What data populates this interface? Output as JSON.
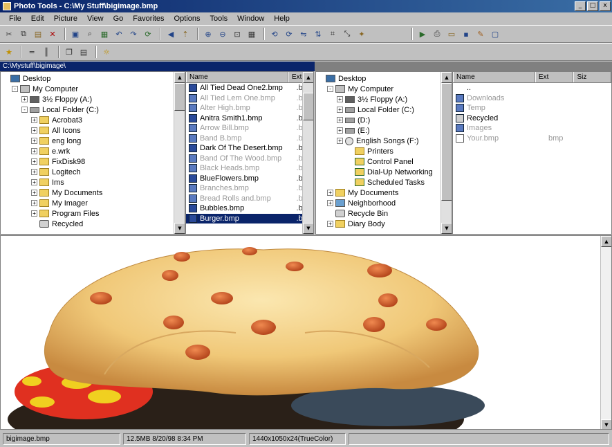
{
  "window": {
    "title": "Photo Tools - C:\\My Stuff\\bigimage.bmp",
    "minimize_label": "_",
    "maximize_label": "□",
    "close_label": "x"
  },
  "menu": [
    "File",
    "Edit",
    "Picture",
    "View",
    "Go",
    "Favorites",
    "Options",
    "Tools",
    "Window",
    "Help"
  ],
  "path_bar": {
    "text": "C:\\Mystuff\\bigimage\\"
  },
  "left_tree": [
    {
      "label": "Desktop",
      "depth": 0,
      "icon": "desktop-icon",
      "expander": ""
    },
    {
      "label": "My Computer",
      "depth": 1,
      "icon": "computer-icon",
      "expander": "-"
    },
    {
      "label": "3½ Floppy (A:)",
      "depth": 2,
      "icon": "floppy-icon",
      "expander": "+"
    },
    {
      "label": "Local Folder (C:)",
      "depth": 2,
      "icon": "drive-icon",
      "expander": "-"
    },
    {
      "label": "Acrobat3",
      "depth": 3,
      "icon": "folder-icon",
      "expander": "+"
    },
    {
      "label": "All Icons",
      "depth": 3,
      "icon": "folder-icon",
      "expander": "+"
    },
    {
      "label": "eng long",
      "depth": 3,
      "icon": "folder-icon",
      "expander": "+"
    },
    {
      "label": "e.wrk",
      "depth": 3,
      "icon": "folder-icon",
      "expander": "+"
    },
    {
      "label": "FixDisk98",
      "depth": 3,
      "icon": "folder-icon",
      "expander": "+"
    },
    {
      "label": "Logitech",
      "depth": 3,
      "icon": "folder-icon",
      "expander": "+"
    },
    {
      "label": "Ims",
      "depth": 3,
      "icon": "folder-icon",
      "expander": "+"
    },
    {
      "label": "My Documents",
      "depth": 3,
      "icon": "folder-icon",
      "expander": "+"
    },
    {
      "label": "My Imager",
      "depth": 3,
      "icon": "folder-icon",
      "expander": "+"
    },
    {
      "label": "Program Files",
      "depth": 3,
      "icon": "folder-icon",
      "expander": "+"
    },
    {
      "label": "Recycled",
      "depth": 3,
      "icon": "recycle-icon",
      "expander": ""
    }
  ],
  "file_list": {
    "headers": [
      "Name",
      "Ext"
    ],
    "rows": [
      {
        "name": "All Tied Dead One2.bmp",
        "ext": ".bmp",
        "faint": false,
        "selected": false
      },
      {
        "name": "All Tied Lem One.bmp",
        "ext": ".bmp",
        "faint": true,
        "selected": false
      },
      {
        "name": "Alter High.bmp",
        "ext": ".bmp",
        "faint": true,
        "selected": false
      },
      {
        "name": "Anitra Smith1.bmp",
        "ext": ".bmp",
        "faint": false,
        "selected": false
      },
      {
        "name": "Arrow Bill.bmp",
        "ext": ".bmp",
        "faint": true,
        "selected": false
      },
      {
        "name": "Band B.bmp",
        "ext": ".bmp",
        "faint": true,
        "selected": false
      },
      {
        "name": "Dark Of The Desert.bmp",
        "ext": ".bmp",
        "faint": false,
        "selected": false
      },
      {
        "name": "Band Of The Wood.bmp",
        "ext": ".bmp",
        "faint": true,
        "selected": false
      },
      {
        "name": "Black Heads.bmp",
        "ext": ".bmp",
        "faint": true,
        "selected": false
      },
      {
        "name": "BlueFlowers.bmp",
        "ext": ".bmp",
        "faint": false,
        "selected": false
      },
      {
        "name": "Branches.bmp",
        "ext": ".bmp",
        "faint": true,
        "selected": false
      },
      {
        "name": "Bread Rolls and.bmp",
        "ext": ".bmp",
        "faint": true,
        "selected": false
      },
      {
        "name": "Bubbles.bmp",
        "ext": ".bmp",
        "faint": false,
        "selected": false
      },
      {
        "name": "Burger.bmp",
        "ext": ".bmp",
        "faint": false,
        "selected": true
      }
    ]
  },
  "right_tree": [
    {
      "label": "Desktop",
      "depth": 0,
      "icon": "desktop-icon",
      "expander": ""
    },
    {
      "label": "My Computer",
      "depth": 1,
      "icon": "computer-icon",
      "expander": "-"
    },
    {
      "label": "3½ Floppy (A:)",
      "depth": 2,
      "icon": "floppy-icon",
      "expander": "+"
    },
    {
      "label": "Local Folder (C:)",
      "depth": 2,
      "icon": "drive-icon",
      "expander": "+"
    },
    {
      "label": "(D:)",
      "depth": 2,
      "icon": "drive-icon",
      "expander": "+"
    },
    {
      "label": "(E:)",
      "depth": 2,
      "icon": "drive-icon",
      "expander": "+"
    },
    {
      "label": "English Songs (F:)",
      "depth": 2,
      "icon": "cd-icon",
      "expander": "+"
    },
    {
      "label": "Printers",
      "depth": 3,
      "icon": "folder-icon",
      "expander": ""
    },
    {
      "label": "Control Panel",
      "depth": 3,
      "icon": "control-panel-icon",
      "expander": ""
    },
    {
      "label": "Dial-Up Networking",
      "depth": 3,
      "icon": "control-panel-icon",
      "expander": ""
    },
    {
      "label": "Scheduled Tasks",
      "depth": 3,
      "icon": "control-panel-icon",
      "expander": ""
    },
    {
      "label": "My Documents",
      "depth": 1,
      "icon": "folder-icon",
      "expander": "+"
    },
    {
      "label": "Neighborhood",
      "depth": 1,
      "icon": "network-icon",
      "expander": "+"
    },
    {
      "label": "Recycle Bin",
      "depth": 1,
      "icon": "recycle-icon",
      "expander": ""
    },
    {
      "label": "Diary Body",
      "depth": 1,
      "icon": "folder-icon",
      "expander": "+"
    }
  ],
  "right_list": {
    "headers": [
      "Name",
      "Ext",
      "Siz"
    ],
    "rows": [
      {
        "name": "..",
        "ext": "",
        "icon": "folder-up-icon",
        "faint": false
      },
      {
        "name": "Downloads",
        "ext": "",
        "icon": "folder-icon",
        "faint": true
      },
      {
        "name": "Temp",
        "ext": "",
        "icon": "folder-icon",
        "faint": true
      },
      {
        "name": "Recycled",
        "ext": "",
        "icon": "recycle-icon",
        "faint": false
      },
      {
        "name": "Images",
        "ext": "",
        "icon": "folder-icon",
        "faint": true
      },
      {
        "name": "Your.bmp",
        "ext": "bmp",
        "icon": "file-icon",
        "faint": true
      }
    ]
  },
  "viewer": {
    "image_name": "burger-image"
  },
  "status": {
    "cell1": "bigimage.bmp",
    "cell2": "12.5MB  8/20/98  8:34 PM",
    "cell3": "1440x1050x24(TrueColor)"
  },
  "colors": {
    "title_bar": "#0a246a",
    "selection": "#0a246a",
    "bun": "#f0c878",
    "tomato": "#e03020"
  }
}
